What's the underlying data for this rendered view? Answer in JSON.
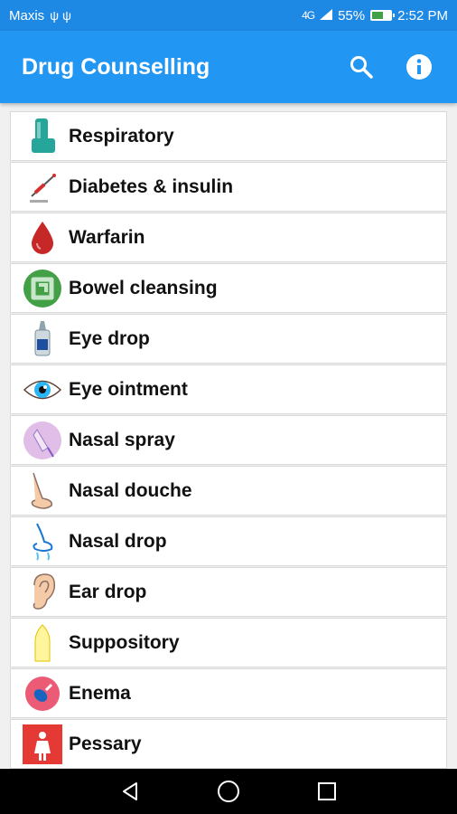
{
  "status": {
    "carrier": "Maxis",
    "usb_icons": "ψ ψ",
    "network": "4G",
    "battery": "55%",
    "battery_level": 0.55,
    "time": "2:52 PM"
  },
  "app_bar": {
    "title": "Drug Counselling",
    "actions": [
      "search-icon",
      "info-icon"
    ]
  },
  "list": {
    "items": [
      {
        "label": "Respiratory",
        "icon": "inhaler-icon"
      },
      {
        "label": "Diabetes & insulin",
        "icon": "insulin-syringe-icon"
      },
      {
        "label": "Warfarin",
        "icon": "blood-drop-icon"
      },
      {
        "label": "Bowel cleansing",
        "icon": "intestine-icon"
      },
      {
        "label": "Eye drop",
        "icon": "eye-drop-bottle-icon"
      },
      {
        "label": "Eye ointment",
        "icon": "eye-icon"
      },
      {
        "label": "Nasal spray",
        "icon": "nasal-spray-icon"
      },
      {
        "label": "Nasal douche",
        "icon": "nose-icon"
      },
      {
        "label": "Nasal drop",
        "icon": "nasal-drop-icon"
      },
      {
        "label": "Ear drop",
        "icon": "ear-icon"
      },
      {
        "label": "Suppository",
        "icon": "suppository-icon"
      },
      {
        "label": "Enema",
        "icon": "enema-icon"
      },
      {
        "label": "Pessary",
        "icon": "pessary-icon"
      }
    ]
  },
  "nav": [
    "back-icon",
    "home-icon",
    "recents-icon"
  ],
  "colors": {
    "status_bar": "#1e88e5",
    "app_bar": "#2196f3",
    "background": "#f0f0f0"
  }
}
